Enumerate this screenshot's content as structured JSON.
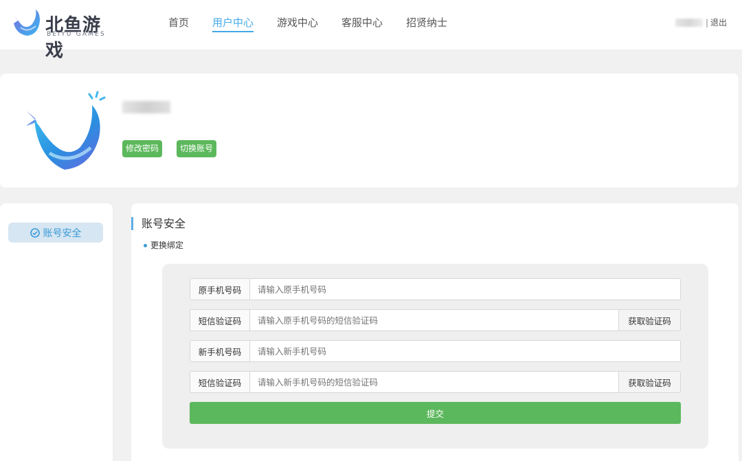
{
  "header": {
    "logo_cn": "北鱼游戏",
    "logo_en": "BEIYU GAMES",
    "nav": [
      {
        "label": "首页"
      },
      {
        "label": "用户中心",
        "active": true
      },
      {
        "label": "游戏中心"
      },
      {
        "label": "客服中心"
      },
      {
        "label": "招贤纳士"
      }
    ],
    "separator": "|",
    "logout": "退出"
  },
  "profile": {
    "change_password": "修改密码",
    "switch_account": "切换账号"
  },
  "sidebar": {
    "items": [
      {
        "label": "账号安全",
        "icon": "check-circle-icon"
      }
    ]
  },
  "main": {
    "section_title": "账号安全",
    "sub_title": "更换绑定",
    "form": {
      "old_phone_label": "原手机号码",
      "old_phone_placeholder": "请输入原手机号码",
      "old_code_label": "短信验证码",
      "old_code_placeholder": "请输入原手机号码的短信验证码",
      "get_code_label": "获取验证码",
      "new_phone_label": "新手机号码",
      "new_phone_placeholder": "请输入新手机号码",
      "new_code_label": "短信验证码",
      "new_code_placeholder": "请输入新手机号码的短信验证码",
      "submit_label": "提交"
    }
  },
  "colors": {
    "accent": "#43a9e8",
    "green": "#5cb85c"
  }
}
